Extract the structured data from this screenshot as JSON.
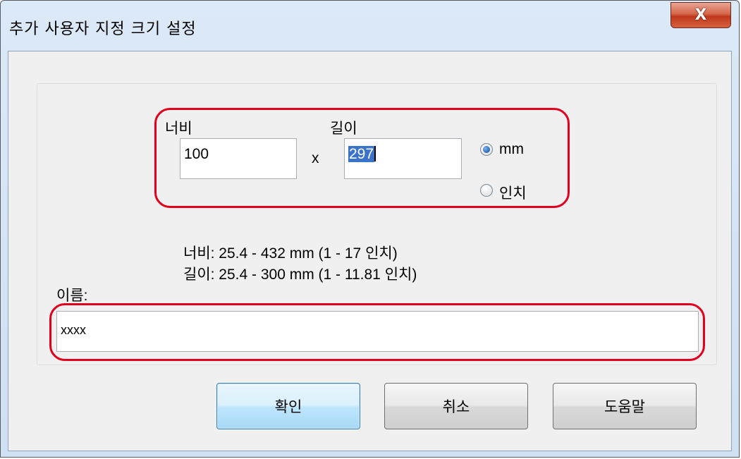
{
  "window": {
    "title": "추가 사용자 지정 크기 설정",
    "close_label": "X"
  },
  "size": {
    "width_label": "너비",
    "length_label": "길이",
    "width_value": "100",
    "separator": "x",
    "length_value": "297",
    "units": [
      {
        "label": "mm",
        "selected": true
      },
      {
        "label": "인치",
        "selected": false
      }
    ]
  },
  "info": {
    "width_range": "너비: 25.4 - 432 mm (1 - 17 인치)",
    "length_range": "길이: 25.4 - 300 mm (1 - 11.81 인치)"
  },
  "name": {
    "label": "이름:",
    "value": "xxxx"
  },
  "buttons": {
    "ok": "확인",
    "cancel": "취소",
    "help": "도움말"
  },
  "colors": {
    "highlight": "#e1001e",
    "selection": "#3a73c9",
    "title_bar": "#cfe0f3"
  }
}
